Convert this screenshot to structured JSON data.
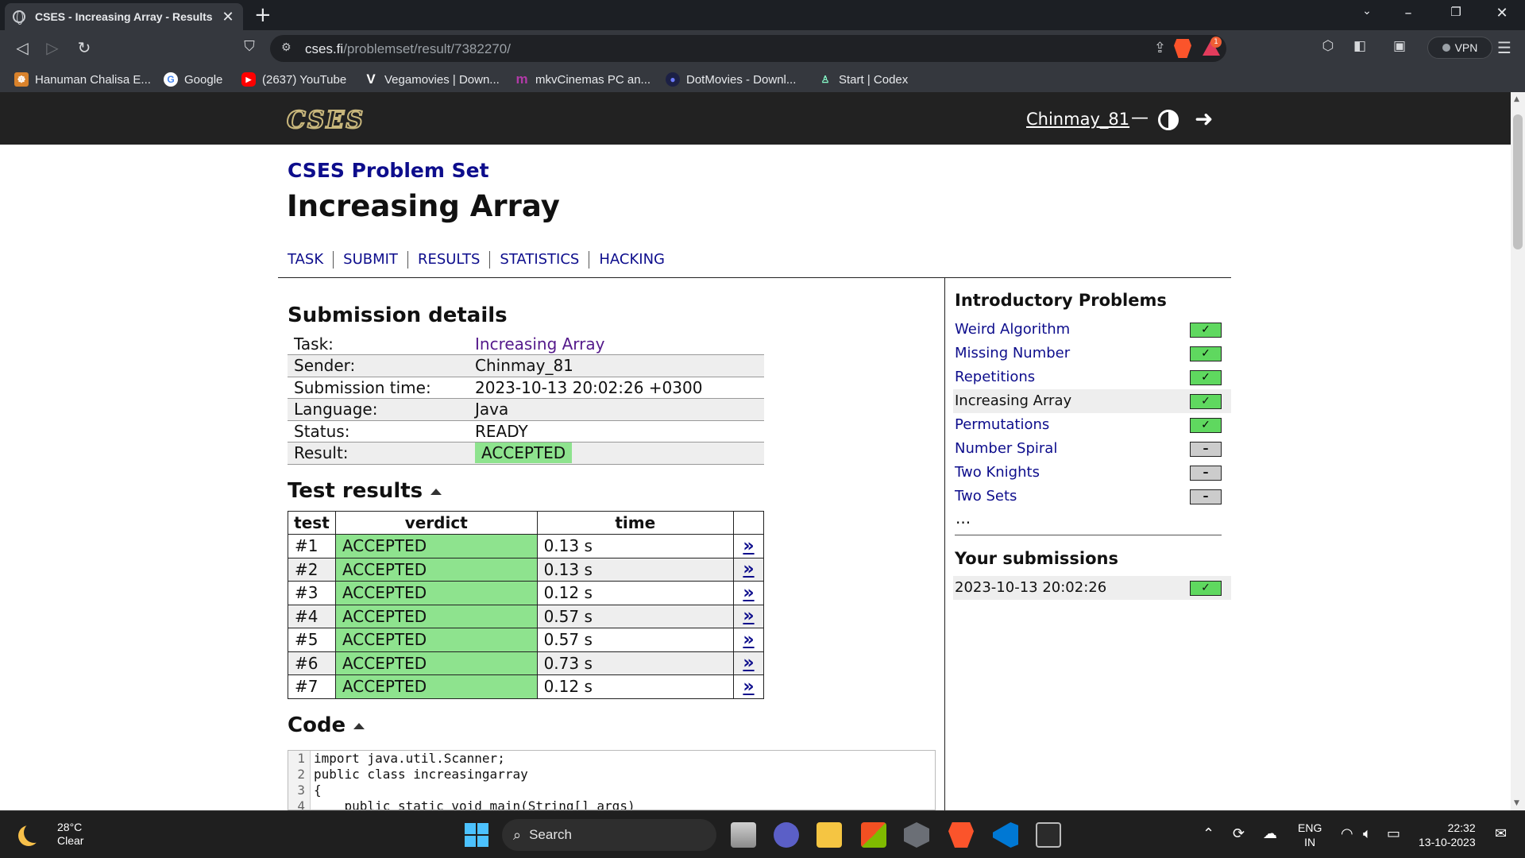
{
  "browser": {
    "tab_title": "CSES - Increasing Array - Results",
    "tab_close": "✕",
    "new_tab": "+",
    "url_host": "cses.fi",
    "url_path": "/problemset/result/7382270/",
    "rewards_badge": "1",
    "vpn_label": "VPN",
    "bookmarks": [
      {
        "label": "Hanuman Chalisa E...",
        "icon": "hanuman-icon",
        "color": "#d9822b"
      },
      {
        "label": "Google",
        "icon": "google-icon",
        "color": "#ffffff"
      },
      {
        "label": "(2637) YouTube",
        "icon": "youtube-icon",
        "color": "#ff0000"
      },
      {
        "label": "Vegamovies | Down...",
        "icon": "vegamovies-icon",
        "color": "#ffffff"
      },
      {
        "label": "mkvCinemas PC an...",
        "icon": "mkvcinemas-icon",
        "color": "#b23aa8"
      },
      {
        "label": "DotMovies - Downl...",
        "icon": "dotmovies-icon",
        "color": "#3a4bd9"
      },
      {
        "label": "Start | Codex",
        "icon": "codex-icon",
        "color": "#5aa0a0"
      }
    ]
  },
  "site": {
    "logo": "CSES",
    "username": "Chinmay_81",
    "separator": "—"
  },
  "page": {
    "set_title": "CSES Problem Set",
    "task_title": "Increasing Array",
    "subnav": [
      "TASK",
      "SUBMIT",
      "RESULTS",
      "STATISTICS",
      "HACKING"
    ]
  },
  "submission": {
    "heading": "Submission details",
    "rows": [
      {
        "key": "Task:",
        "value": "Increasing Array"
      },
      {
        "key": "Sender:",
        "value": "Chinmay_81"
      },
      {
        "key": "Submission time:",
        "value": "2023-10-13 20:02:26 +0300"
      },
      {
        "key": "Language:",
        "value": "Java"
      },
      {
        "key": "Status:",
        "value": "READY"
      },
      {
        "key": "Result:",
        "value": "ACCEPTED"
      }
    ]
  },
  "tests": {
    "heading": "Test results",
    "columns": [
      "test",
      "verdict",
      "time",
      ""
    ],
    "link_glyph": "»",
    "rows": [
      {
        "test": "#1",
        "verdict": "ACCEPTED",
        "time": "0.13 s"
      },
      {
        "test": "#2",
        "verdict": "ACCEPTED",
        "time": "0.13 s"
      },
      {
        "test": "#3",
        "verdict": "ACCEPTED",
        "time": "0.12 s"
      },
      {
        "test": "#4",
        "verdict": "ACCEPTED",
        "time": "0.57 s"
      },
      {
        "test": "#5",
        "verdict": "ACCEPTED",
        "time": "0.57 s"
      },
      {
        "test": "#6",
        "verdict": "ACCEPTED",
        "time": "0.73 s"
      },
      {
        "test": "#7",
        "verdict": "ACCEPTED",
        "time": "0.12 s"
      }
    ]
  },
  "code": {
    "heading": "Code",
    "lines": [
      {
        "n": "1",
        "text": "import java.util.Scanner;"
      },
      {
        "n": "2",
        "text": "public class increasingarray"
      },
      {
        "n": "3",
        "text": "{"
      },
      {
        "n": "4",
        "text": "    public static void main(String[] args)"
      }
    ]
  },
  "sidebar": {
    "heading": "Introductory Problems",
    "problems": [
      {
        "name": "Weird Algorithm",
        "status": "solved",
        "mark": "✓"
      },
      {
        "name": "Missing Number",
        "status": "solved",
        "mark": "✓"
      },
      {
        "name": "Repetitions",
        "status": "solved",
        "mark": "✓"
      },
      {
        "name": "Increasing Array",
        "status": "solved",
        "mark": "✓",
        "current": true
      },
      {
        "name": "Permutations",
        "status": "solved",
        "mark": "✓"
      },
      {
        "name": "Number Spiral",
        "status": "unsolved",
        "mark": "–"
      },
      {
        "name": "Two Knights",
        "status": "unsolved",
        "mark": "–"
      },
      {
        "name": "Two Sets",
        "status": "unsolved",
        "mark": "–"
      }
    ],
    "ellipsis": "...",
    "submissions_heading": "Your submissions",
    "submissions": [
      {
        "time": "2023-10-13 20:02:26",
        "mark": "✓"
      }
    ]
  },
  "taskbar": {
    "temperature": "28°C",
    "weather": "Clear",
    "search_label": "Search",
    "lang_top": "ENG",
    "lang_bottom": "IN",
    "clock_time": "22:32",
    "clock_date": "13-10-2023"
  },
  "colors": {
    "accepted_bg": "#8ee38e",
    "link_blue": "#0d0d8c",
    "header_bg": "#222222"
  }
}
